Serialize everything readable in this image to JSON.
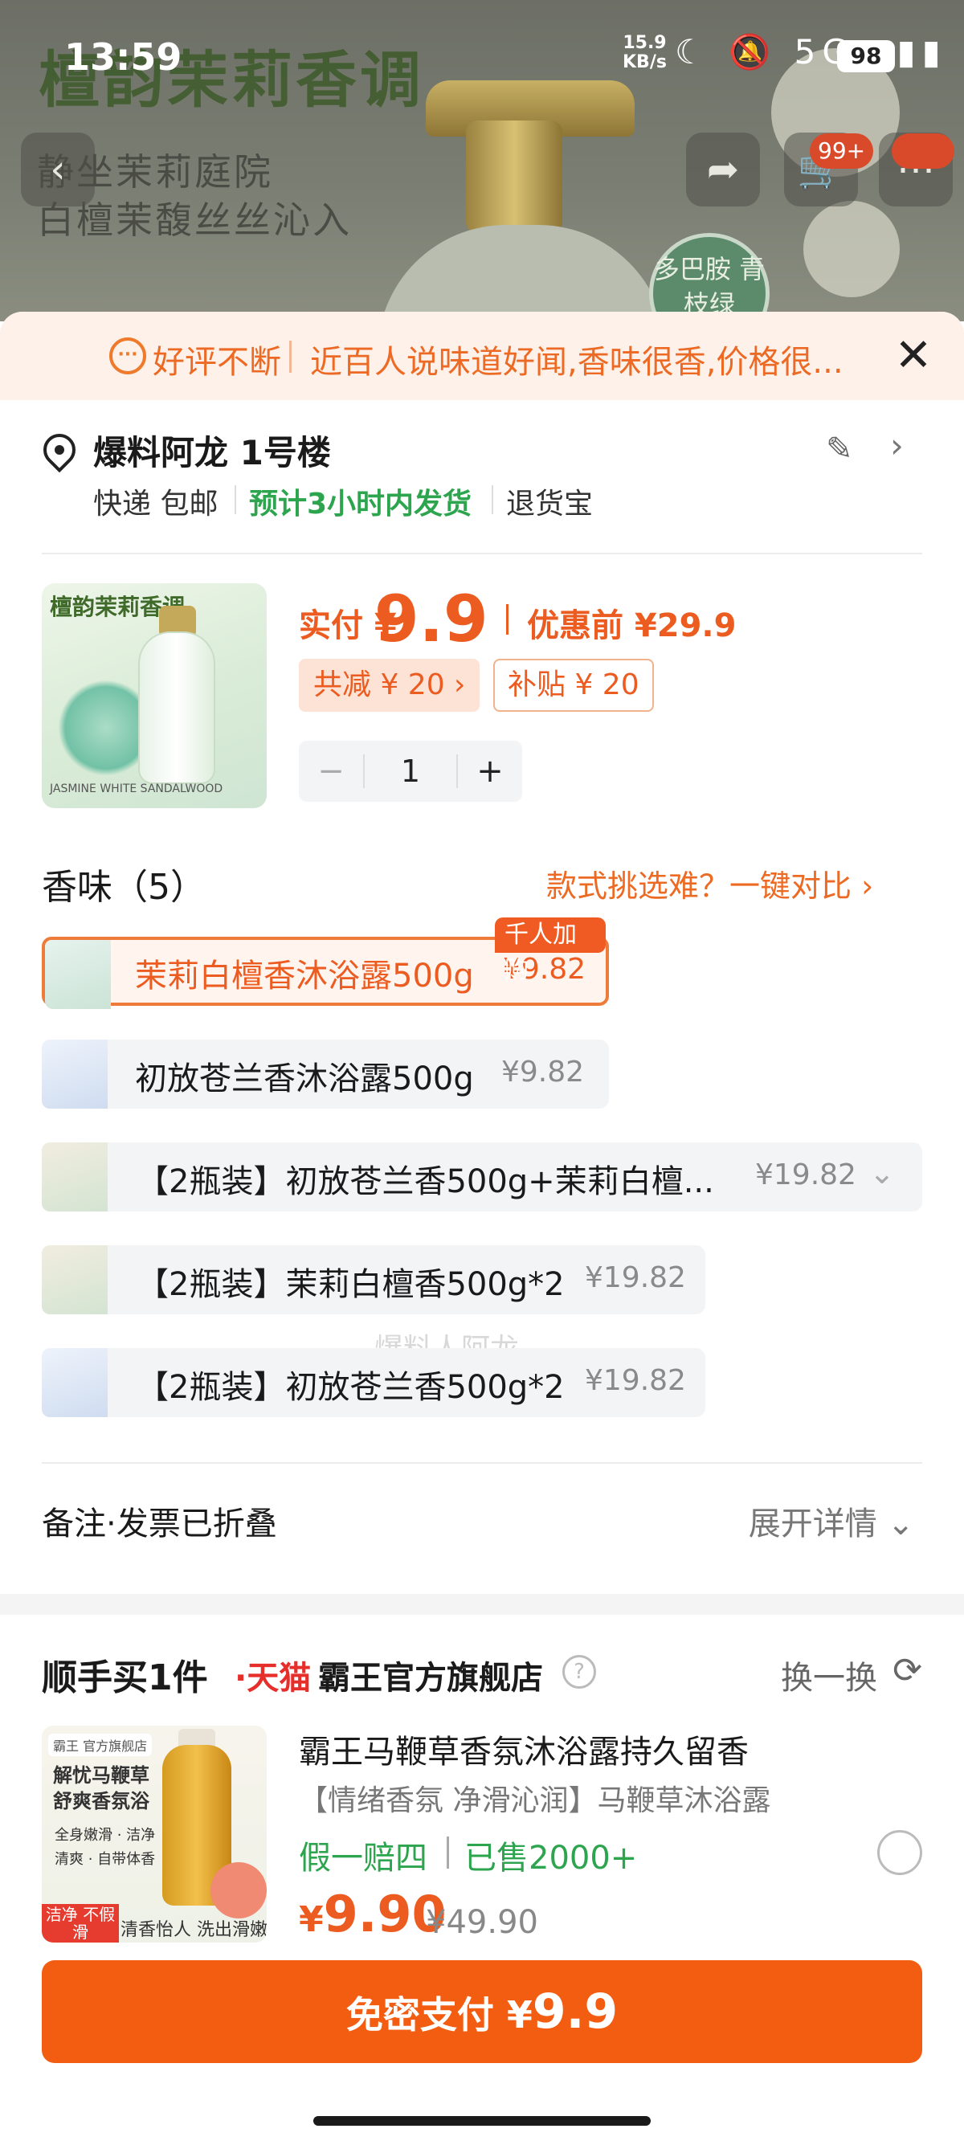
{
  "status": {
    "time": "13:59",
    "speed_val": "15.9",
    "speed_unit": "KB/s",
    "battery": "98",
    "icons": "☾ 🔕 5G ▮▮▮"
  },
  "banner": {
    "title": "檀韵茉莉香调",
    "sub1": "静坐茉莉庭院",
    "sub2": "白檀茉馥丝丝沁入",
    "badge": "多巴胺 青枝绿",
    "cart_badge": "99+"
  },
  "review": {
    "highlight": "好评不断",
    "text": "近百人说味道好闻,香味很香,价格很..."
  },
  "address": {
    "name": "爆料阿龙 1号楼",
    "ship_mode": "快递 包邮",
    "ship_time": "预计3小时内发货",
    "ship_extra": "退货宝"
  },
  "product": {
    "thumb_title": "檀韵茉莉香调",
    "thumb_foot": "JASMINE WHITE SANDALWOOD",
    "price_label": "实付 ¥",
    "price": "9.9",
    "price_before": "优惠前 ¥29.9",
    "discount": "共减 ¥ 20 ›",
    "subsidy": "补贴 ¥ 20",
    "qty": "1"
  },
  "scents": {
    "title": "香味（5）",
    "compare": "款式挑选难？一键对比 ›",
    "options": [
      {
        "name": "茉莉白檀香沐浴露500g",
        "price": "¥9.82",
        "tag": "千人加购",
        "selected": true
      },
      {
        "name": "初放苍兰香沐浴露500g",
        "price": "¥9.82"
      },
      {
        "name": "【2瓶装】初放苍兰香500g+茉莉白檀...",
        "price": "¥19.82"
      },
      {
        "name": "【2瓶装】茉莉白檀香500g*2",
        "price": "¥19.82"
      },
      {
        "name": "【2瓶装】初放苍兰香500g*2",
        "price": "¥19.82"
      }
    ],
    "watermark": "爆料人阿龙"
  },
  "remark": {
    "label": "备注·发票已折叠",
    "link": "展开详情 ⌄"
  },
  "shunshou": {
    "title": "顺手买1件",
    "tmall": "·天猫",
    "store": "霸王官方旗舰店",
    "swap": "换一换",
    "item": {
      "name": "霸王马鞭草香氛沐浴露持久留香",
      "desc": "【情绪香氛 净滑沁润】马鞭草沐浴露",
      "promo": "假一赔四",
      "sold": "已售2000+",
      "price_currency": "¥",
      "price": "9.90",
      "orig": "¥49.90",
      "thumb_logo": "霸王 官方旗舰店",
      "thumb_line1": "解忧马鞭草",
      "thumb_line2": "舒爽香氛浴",
      "thumb_bullets": "全身嫩滑 · 洁净清爽 · 自带体香",
      "thumb_tag": "洁净 不假滑",
      "thumb_bottom": "清香怡人 洗出滑嫩肌"
    }
  },
  "pay": {
    "label": "免密支付 ¥",
    "amount": "9.9"
  }
}
